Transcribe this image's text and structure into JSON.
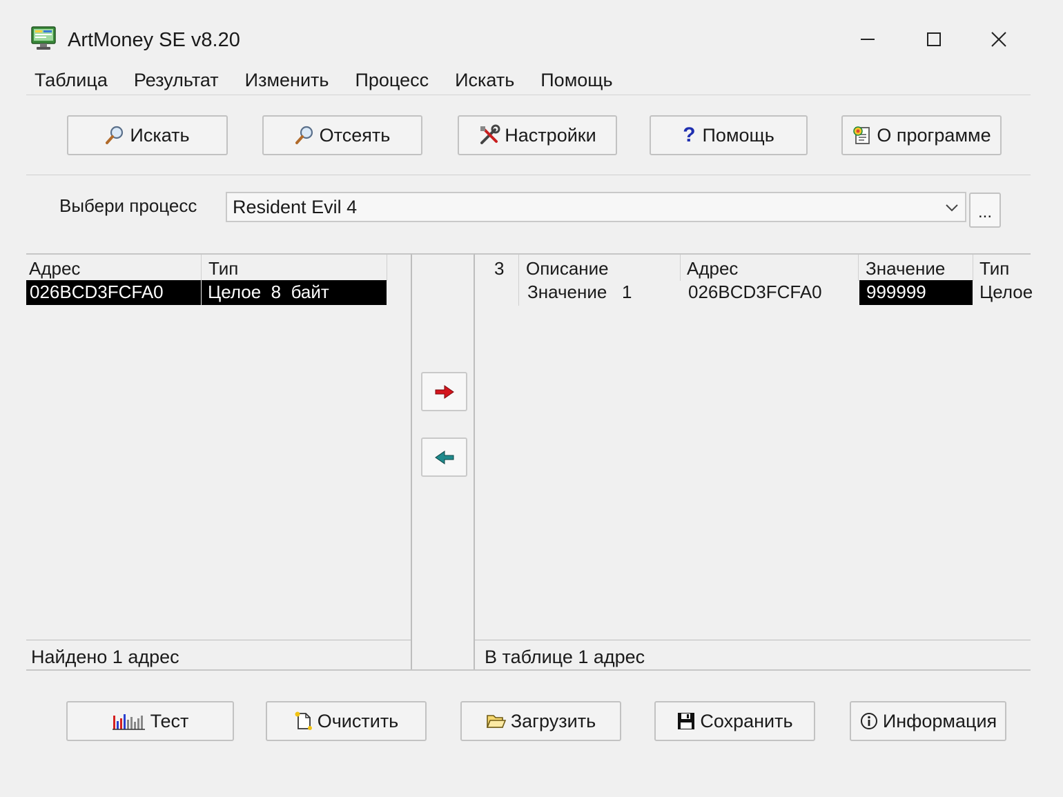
{
  "window": {
    "title": "ArtMoney SE v8.20"
  },
  "menu": [
    "Таблица",
    "Результат",
    "Изменить",
    "Процесс",
    "Искать",
    "Помощь"
  ],
  "toolbar": {
    "search": "Искать",
    "filter": "Отсеять",
    "settings": "Настройки",
    "help": "Помощь",
    "about": "О программе"
  },
  "process": {
    "label": "Выбери процесс",
    "selected": "Resident Evil 4",
    "browse": "..."
  },
  "left_table": {
    "columns": [
      "Адрес",
      "Тип"
    ],
    "rows": [
      {
        "address": "026BCD3FCFA0",
        "type": "Целое  8  байт"
      }
    ],
    "footer": "Найдено 1 адрес"
  },
  "right_table": {
    "columns": [
      "3",
      "Описание",
      "Адрес",
      "Значение",
      "Тип"
    ],
    "rows": [
      {
        "description": "Значение   1",
        "address": "026BCD3FCFA0",
        "value": "999999",
        "type": "Целое"
      }
    ],
    "footer": "В таблице 1 адрес"
  },
  "bottom": {
    "test": "Тест",
    "clear": "Очистить",
    "load": "Загрузить",
    "save": "Сохранить",
    "info": "Информация"
  },
  "colors": {
    "selection": "#000000",
    "arrow_right": "#d4141c",
    "arrow_left": "#1f8a8c"
  }
}
